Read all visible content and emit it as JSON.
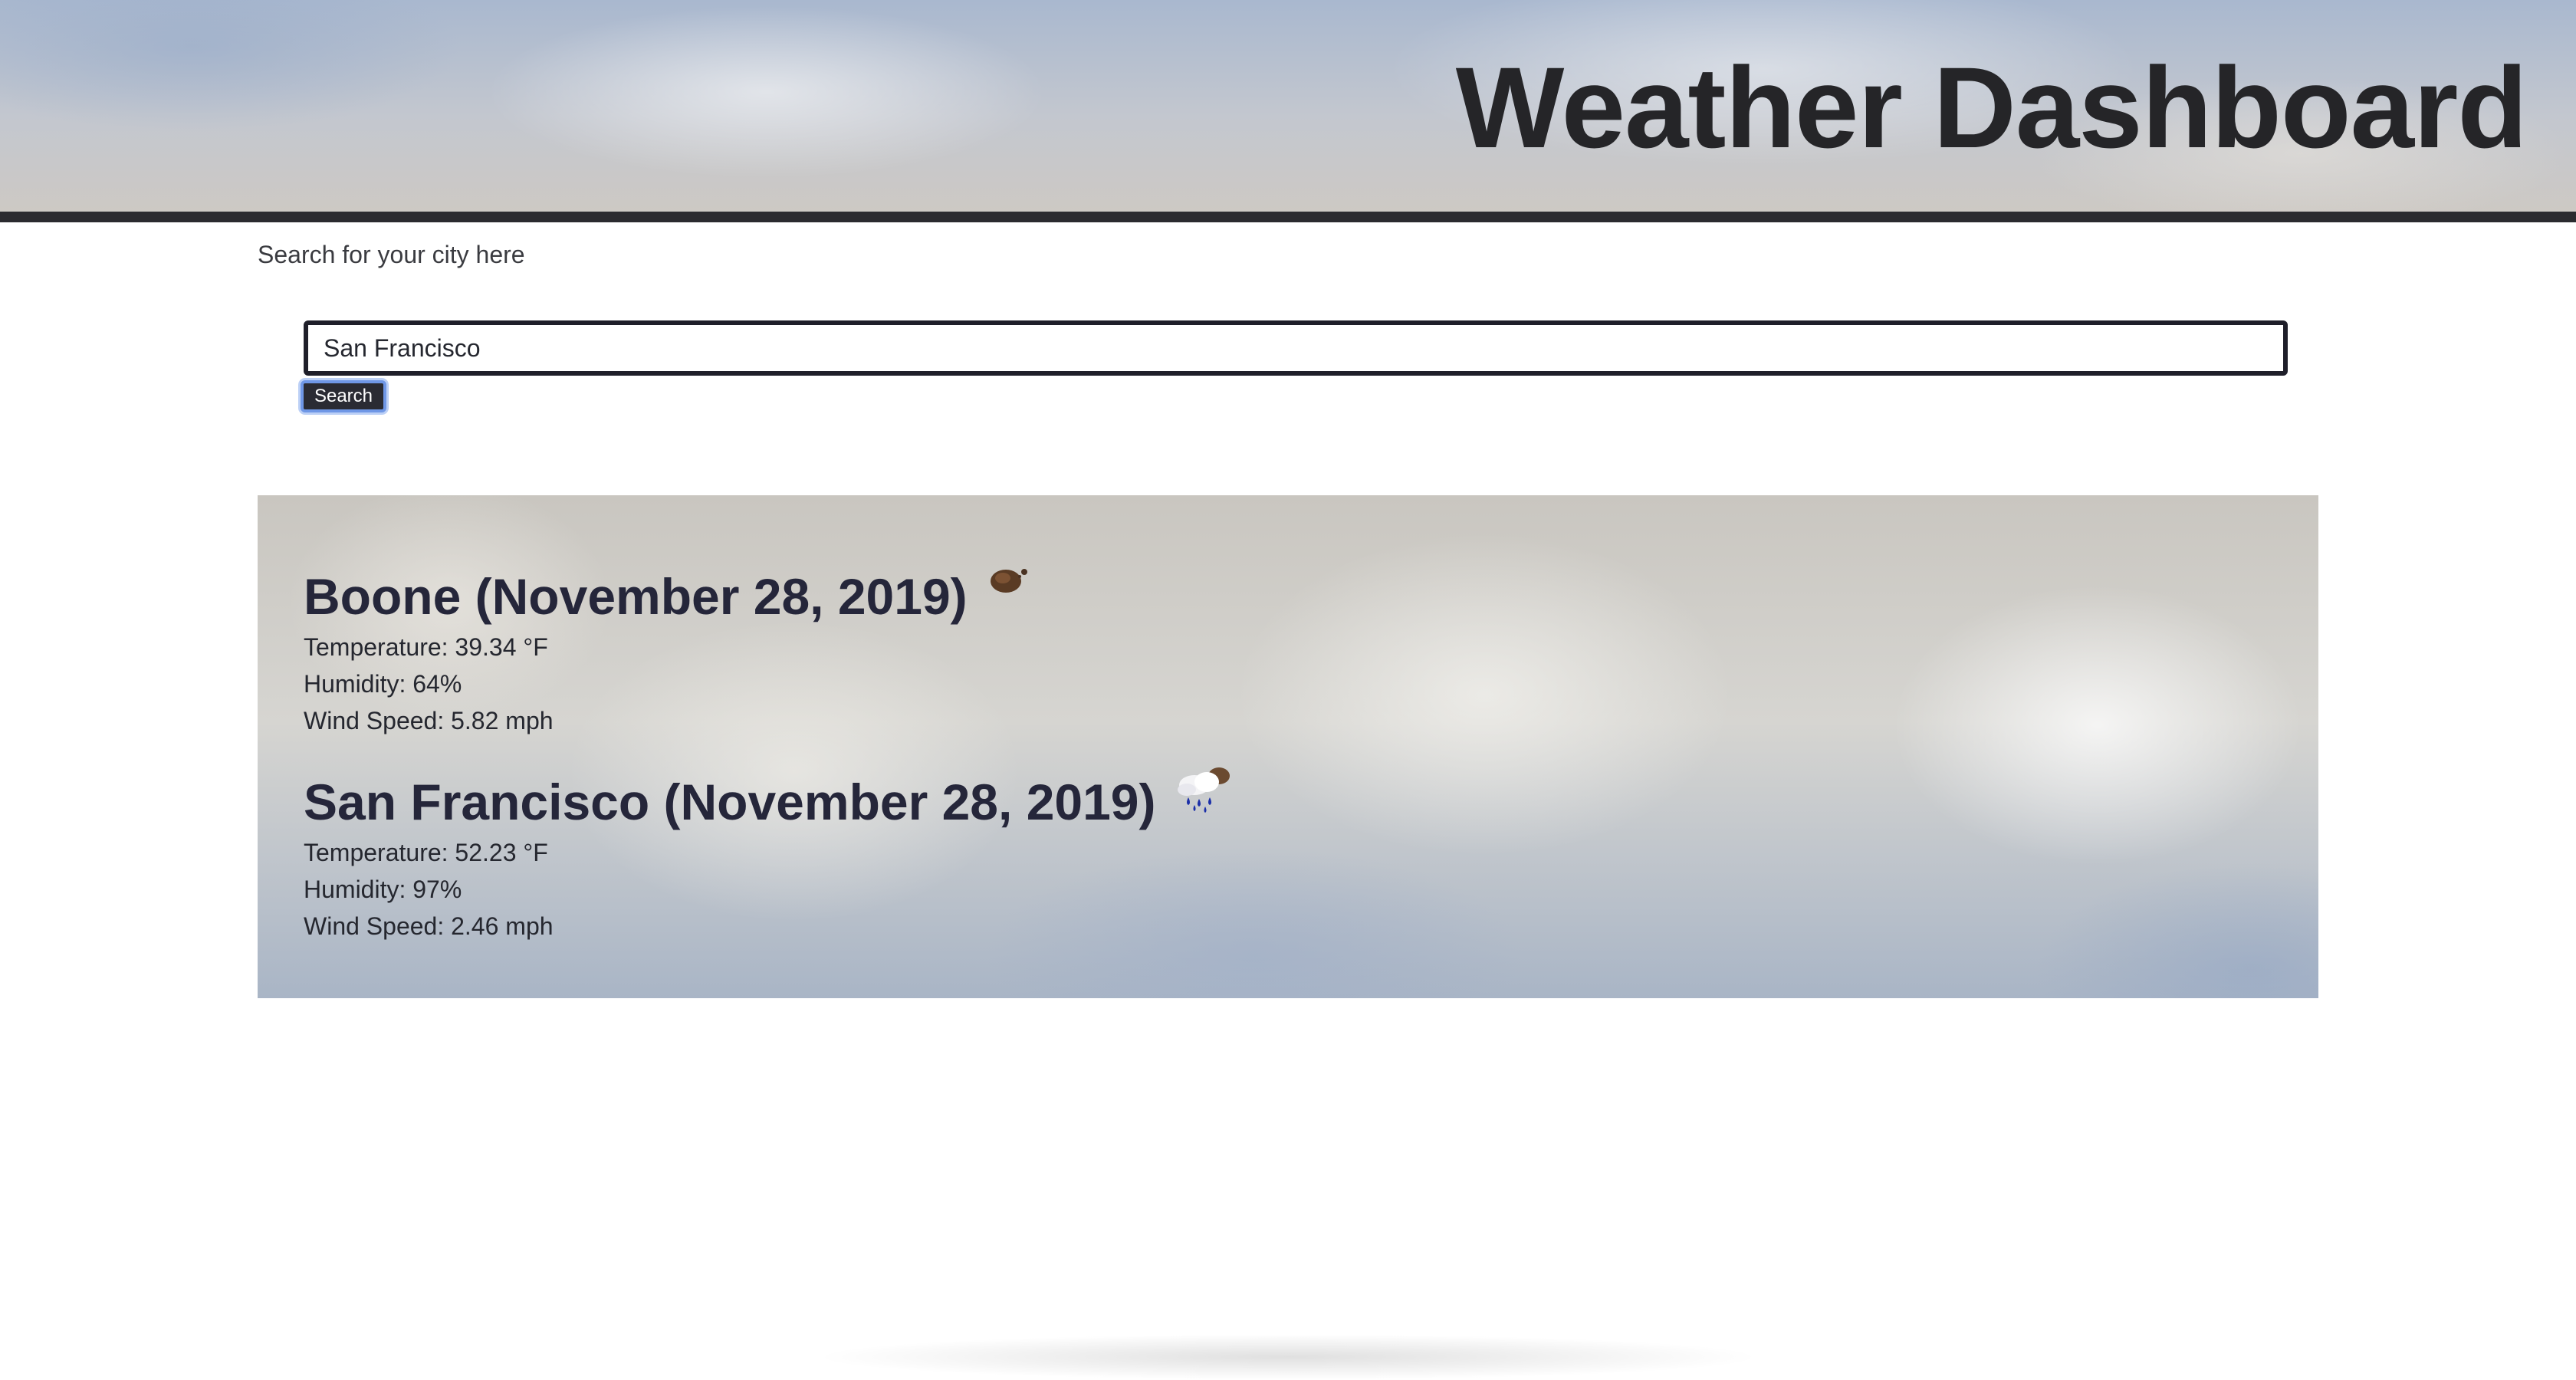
{
  "header": {
    "title": "Weather Dashboard"
  },
  "search": {
    "label": "Search for your city here",
    "value": "San Francisco",
    "button_label": "Search"
  },
  "results": [
    {
      "heading": "Boone (November 28, 2019)",
      "icon": "dark-cloud-icon",
      "temperature": "Temperature: 39.34 °F",
      "humidity": "Humidity: 64%",
      "wind": "Wind Speed: 5.82 mph"
    },
    {
      "heading": "San Francisco (November 28, 2019)",
      "icon": "rain-cloud-icon",
      "temperature": "Temperature: 52.23 °F",
      "humidity": "Humidity: 97%",
      "wind": "Wind Speed: 2.46 mph"
    }
  ],
  "colors": {
    "header_bar": "#2b2b2f",
    "text": "#25272f",
    "button_bg": "#2a2b33",
    "button_focus": "#6f97e6"
  }
}
